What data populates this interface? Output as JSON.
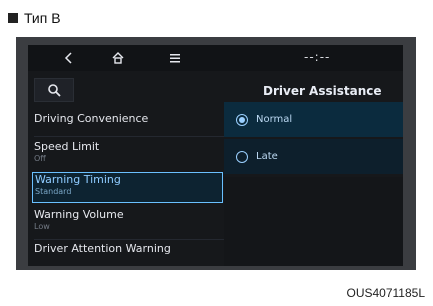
{
  "caption": {
    "text": "Тип B"
  },
  "footer": {
    "code": "OUS4071185L"
  },
  "topbar": {
    "clock": "--:--"
  },
  "header": {
    "title": "Driver Assistance"
  },
  "menu": {
    "items": [
      {
        "label": "Driving Convenience",
        "sub": ""
      },
      {
        "label": "Speed Limit",
        "sub": "Off"
      },
      {
        "label": "Warning Timing",
        "sub": "Standard"
      },
      {
        "label": "Warning Volume",
        "sub": "Low"
      },
      {
        "label": "Driver Attention Warning",
        "sub": ""
      }
    ]
  },
  "options": [
    {
      "label": "Normal",
      "selected": true
    },
    {
      "label": "Late",
      "selected": false
    }
  ],
  "icons": {
    "back": "chevron-left-icon",
    "home": "home-icon",
    "menu": "menu-icon",
    "search": "search-icon"
  },
  "colors": {
    "accent": "#6ac0ff",
    "screen_bg": "#16181b",
    "frame_bg": "#3b3d41"
  }
}
